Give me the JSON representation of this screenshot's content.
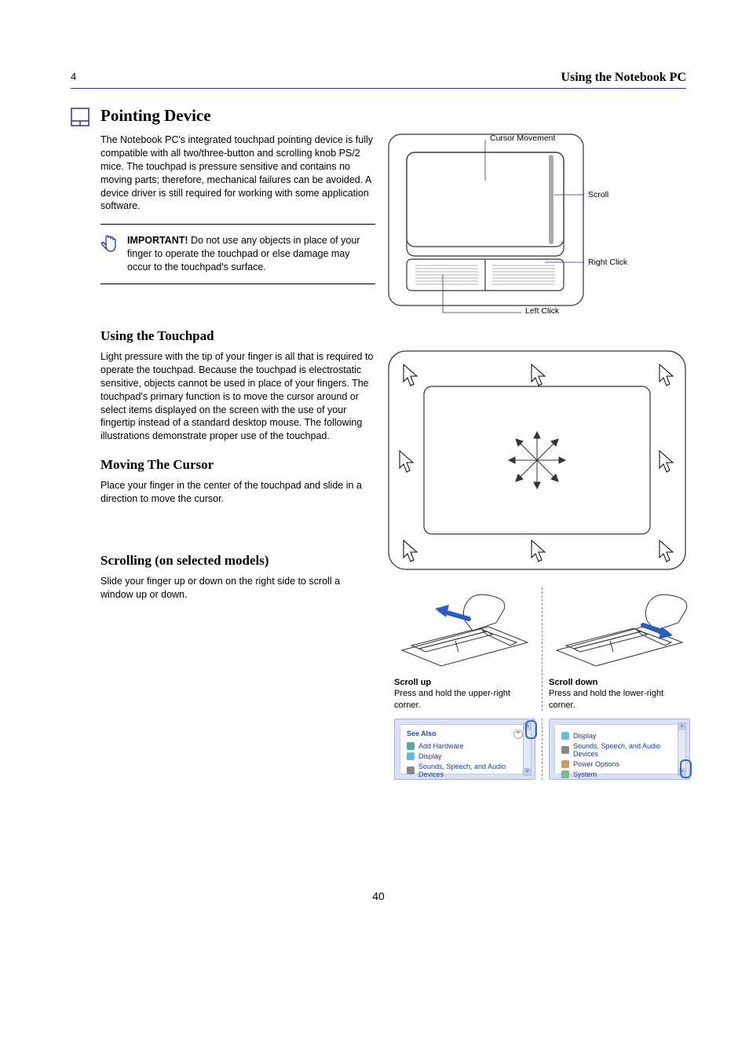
{
  "header": {
    "section_number": "4",
    "section_title": "Using the Notebook PC"
  },
  "pointing": {
    "title": "Pointing Device",
    "intro": "The Notebook PC's integrated touchpad pointing device is fully compatible with all two/three-button and scrolling knob PS/2 mice. The touchpad is pressure sensitive and contains no moving parts; therefore, mechanical failures can be avoided. A device driver is still required for working with some application software."
  },
  "note": {
    "title": "IMPORTANT!",
    "body": "Do not use any objects in place of your finger to operate the touchpad or else damage may occur to the touchpad's surface."
  },
  "diagram": {
    "label_cursor": "Cursor Movement",
    "label_scroll": "Scroll",
    "label_right": "Right Click",
    "label_left": "Left Click"
  },
  "using": {
    "title": "Using the Touchpad",
    "body": "Light pressure with the tip of your finger is all that is required to operate the touchpad. Because the touchpad is electrostatic sensitive, objects cannot be used in place of your fingers. The touchpad's primary function is to move the cursor around or select items displayed on the screen with the use of your fingertip instead of a standard desktop mouse. The following illustrations demonstrate proper use of the touchpad."
  },
  "moving": {
    "title": "Moving The Cursor",
    "body": "Place your finger in the center of the touchpad and slide in a direction to move the cursor."
  },
  "scrolling": {
    "title": "Scrolling (on selected models)",
    "body": "Slide your finger up or down on the right side to scroll a window up or down."
  },
  "scroll_fig": {
    "left_caption_bold": "Scroll up",
    "left_caption": "Press and hold the upper-right corner.",
    "right_caption_bold": "Scroll down",
    "right_caption": "Press and hold the lower-right corner."
  },
  "winbox": {
    "see_also": "See Also",
    "add_hardware": "Add Hardware",
    "display": "Display",
    "sounds": "Sounds, Speech, and Audio Devices",
    "power": "Power Options",
    "system": "System"
  },
  "page_number": "40"
}
